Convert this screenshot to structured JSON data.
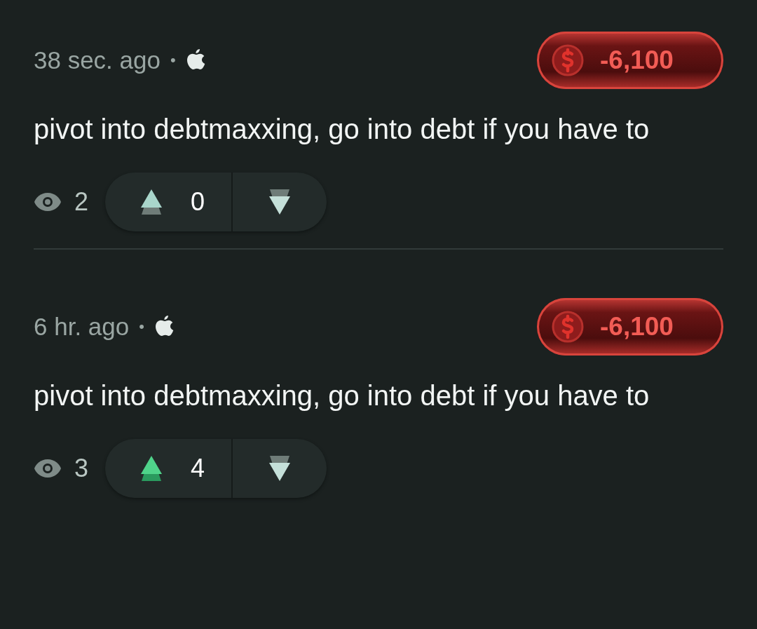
{
  "posts": [
    {
      "time": "38 sec. ago",
      "separator": "•",
      "score": "-6,100",
      "text": "pivot into debtmaxxing, go into debt if you have to",
      "views": "2",
      "upvotes": "0",
      "upvoted": false
    },
    {
      "time": "6 hr. ago",
      "separator": "•",
      "score": "-6,100",
      "text": "pivot into debtmaxxing, go into debt if you have to",
      "views": "3",
      "upvotes": "4",
      "upvoted": true
    }
  ]
}
